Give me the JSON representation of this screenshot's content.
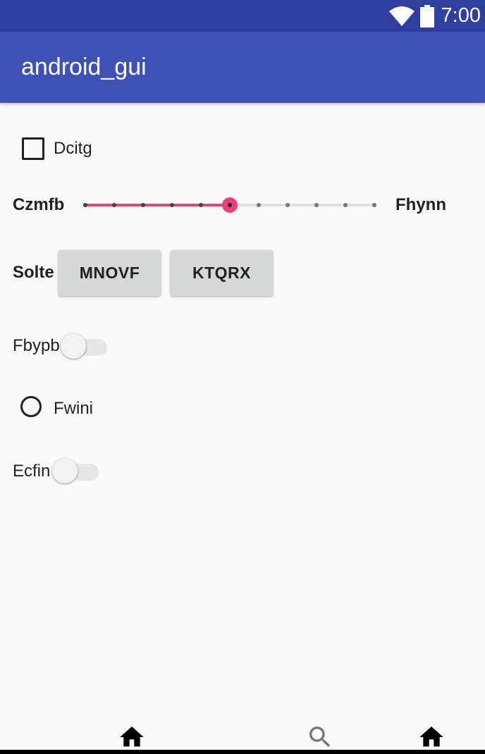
{
  "status_bar": {
    "time": "7:00",
    "icons": [
      "wifi-icon",
      "battery-icon"
    ]
  },
  "app_bar": {
    "title": "android_gui"
  },
  "checkbox": {
    "label": "Dcitg",
    "checked": false
  },
  "seekbar": {
    "left_label": "Czmfb",
    "right_label": "Fhynn",
    "max": 10,
    "value": 5,
    "accent": "#ec407a"
  },
  "buttons_row": {
    "label": "Solte",
    "buttons": [
      "MNOVF",
      "KTQRX"
    ]
  },
  "switch_1": {
    "label": "Fbypb",
    "on": false
  },
  "radio": {
    "label": "Fwini",
    "selected": false
  },
  "switch_2": {
    "label": "Ecfin",
    "on": false
  },
  "bottom_nav": {
    "icons": [
      "home-icon",
      "search-icon",
      "home-icon"
    ]
  },
  "colors": {
    "status_bar": "#303f9f",
    "app_bar": "#3f51b5",
    "background": "#fafafa",
    "button": "#d6d7d7"
  }
}
